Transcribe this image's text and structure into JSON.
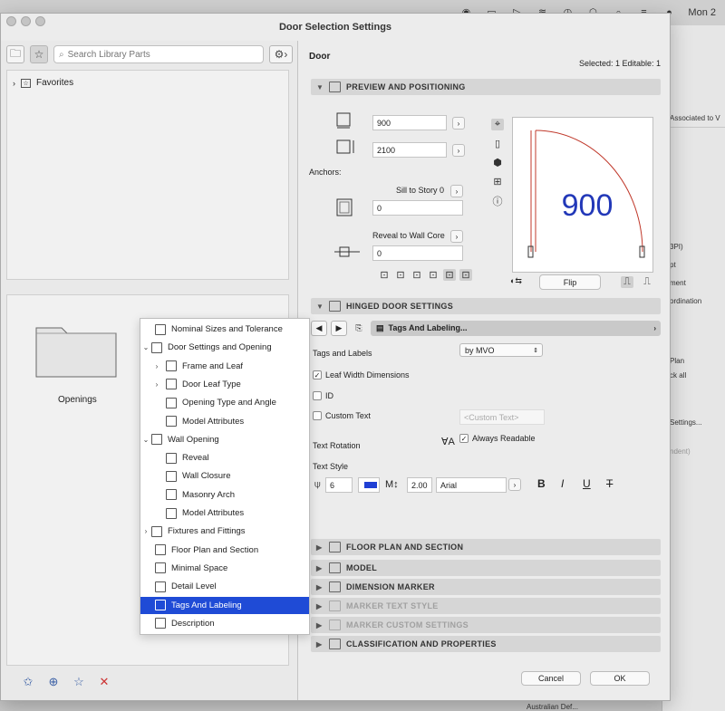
{
  "menubar": {
    "clock": "Mon 2"
  },
  "dialog": {
    "title": "Door Selection Settings"
  },
  "library": {
    "search_placeholder": "Search Library Parts",
    "favorites_label": "Favorites",
    "folder_label": "Openings"
  },
  "header": {
    "element": "Door",
    "selected": "Selected: 1 Editable: 1"
  },
  "preview_section": {
    "title": "PREVIEW AND POSITIONING",
    "width": "900",
    "height": "2100",
    "anchors_label": "Anchors:",
    "sill_label": "Sill to Story 0",
    "sill_value": "0",
    "reveal_label": "Reveal to Wall Core",
    "reveal_value": "0",
    "preview_dim": "900",
    "flip_label": "Flip"
  },
  "hinged_section": {
    "title": "HINGED DOOR SETTINGS",
    "current_tab": "Tags And Labeling...",
    "tags_label": "Tags and Labels",
    "tags_value": "by MVO",
    "leaf_width": "Leaf Width Dimensions",
    "id_label": "ID",
    "custom_text": "Custom Text",
    "custom_text_placeholder": "<Custom Text>",
    "text_rotation": "Text Rotation",
    "always_readable": "Always Readable",
    "text_style": "Text Style",
    "font_size": "6",
    "line_spacing": "2.00",
    "font_name": "Arial",
    "bold": "B",
    "italic": "I",
    "underline": "U",
    "strike": "T"
  },
  "tree": {
    "items": [
      {
        "label": "Nominal Sizes and Tolerance",
        "arrow": ""
      },
      {
        "label": "Door Settings and Opening",
        "arrow": "⌄"
      },
      {
        "label": "Frame and Leaf",
        "arrow": "›"
      },
      {
        "label": "Door Leaf Type",
        "arrow": "›"
      },
      {
        "label": "Opening Type and Angle",
        "arrow": ""
      },
      {
        "label": "Model Attributes",
        "arrow": ""
      },
      {
        "label": "Wall Opening",
        "arrow": "⌄"
      },
      {
        "label": "Reveal",
        "arrow": ""
      },
      {
        "label": "Wall Closure",
        "arrow": ""
      },
      {
        "label": "Masonry Arch",
        "arrow": ""
      },
      {
        "label": "Model Attributes",
        "arrow": ""
      },
      {
        "label": "Fixtures and Fittings",
        "arrow": "›"
      },
      {
        "label": "Floor Plan and Section",
        "arrow": ""
      },
      {
        "label": "Minimal Space",
        "arrow": ""
      },
      {
        "label": "Detail Level",
        "arrow": ""
      },
      {
        "label": "Tags And Labeling",
        "arrow": ""
      },
      {
        "label": "Description",
        "arrow": ""
      }
    ]
  },
  "collapsed_sections": [
    {
      "title": "FLOOR PLAN AND SECTION",
      "enabled": true
    },
    {
      "title": "MODEL",
      "enabled": true
    },
    {
      "title": "DIMENSION MARKER",
      "enabled": true
    },
    {
      "title": "MARKER TEXT STYLE",
      "enabled": false
    },
    {
      "title": "MARKER CUSTOM SETTINGS",
      "enabled": false
    },
    {
      "title": "CLASSIFICATION AND PROPERTIES",
      "enabled": true
    }
  ],
  "footer": {
    "cancel": "Cancel",
    "ok": "OK"
  },
  "background_window": {
    "texts": [
      "Associated to V",
      "3PI)",
      "pt",
      "ment",
      "ordination",
      "Plan",
      "ck all",
      "Settings...",
      "ndent)",
      "Australian Def..."
    ]
  },
  "colors": {
    "accent": "#1f4bd6",
    "preview_dim": "#2238b8",
    "door_line": "#c0392b"
  }
}
